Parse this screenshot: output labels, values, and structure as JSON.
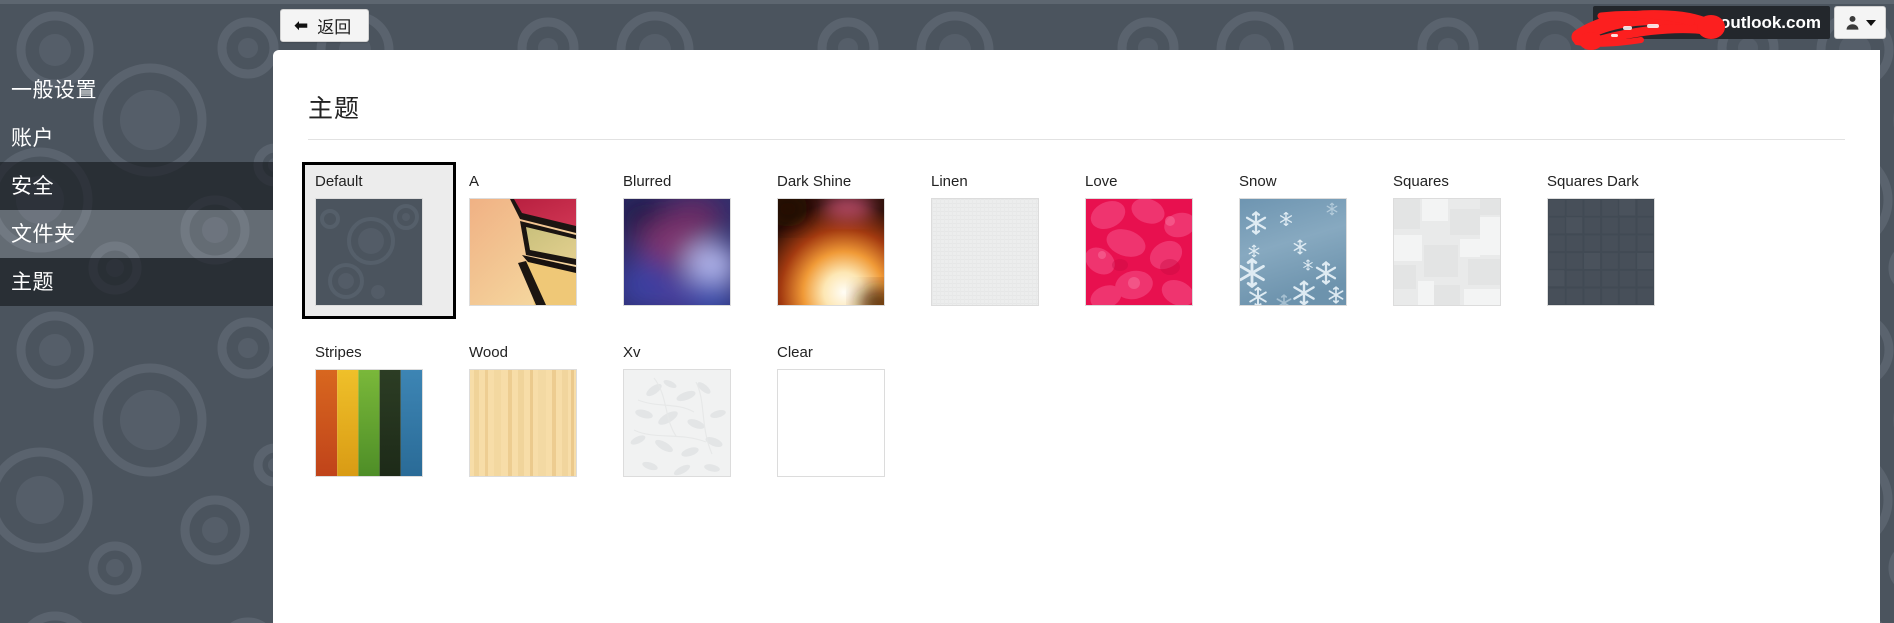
{
  "window": {
    "background_color": "#4b545e",
    "panel_color": "#ffffff"
  },
  "topbar": {
    "back_button": {
      "label": "返回",
      "icon": "arrow-left-icon"
    },
    "account": {
      "email_visible_suffix": "@outlook.com",
      "email_redacted": true,
      "redaction_color": "#fc1f1f",
      "profile_icon": "user-icon",
      "caret_icon": "chevron-down-icon"
    }
  },
  "sidebar": {
    "items": [
      {
        "label": "一般设置",
        "state": "normal"
      },
      {
        "label": "账户",
        "state": "normal"
      },
      {
        "label": "安全",
        "state": "selected"
      },
      {
        "label": "文件夹",
        "state": "hover"
      },
      {
        "label": "主题",
        "state": "selected"
      }
    ]
  },
  "main": {
    "title": "主题",
    "themes": [
      {
        "name": "Default",
        "selected": true,
        "thumb": "default"
      },
      {
        "name": "A",
        "selected": false,
        "thumb": "a"
      },
      {
        "name": "Blurred",
        "selected": false,
        "thumb": "blurred"
      },
      {
        "name": "Dark Shine",
        "selected": false,
        "thumb": "darkshine"
      },
      {
        "name": "Linen",
        "selected": false,
        "thumb": "linen"
      },
      {
        "name": "Love",
        "selected": false,
        "thumb": "love"
      },
      {
        "name": "Snow",
        "selected": false,
        "thumb": "snow"
      },
      {
        "name": "Squares",
        "selected": false,
        "thumb": "squares"
      },
      {
        "name": "Squares Dark",
        "selected": false,
        "thumb": "squaresdark"
      },
      {
        "name": "Stripes",
        "selected": false,
        "thumb": "stripes"
      },
      {
        "name": "Wood",
        "selected": false,
        "thumb": "wood"
      },
      {
        "name": "Xv",
        "selected": false,
        "thumb": "xv"
      },
      {
        "name": "Clear",
        "selected": false,
        "thumb": "clear"
      }
    ]
  },
  "palette": {
    "sidebar_bg": "#4b545e",
    "selected_row": "#1d2228",
    "accent_dark": "#23272c",
    "stripes": [
      "#d3551f",
      "#e0a81c",
      "#5a9e2e",
      "#25351f",
      "#2f78a8"
    ],
    "love_pink": "#ef1f5e",
    "snow_blue": "#7ba2bb",
    "wood_tan": "#f5d9a2"
  }
}
